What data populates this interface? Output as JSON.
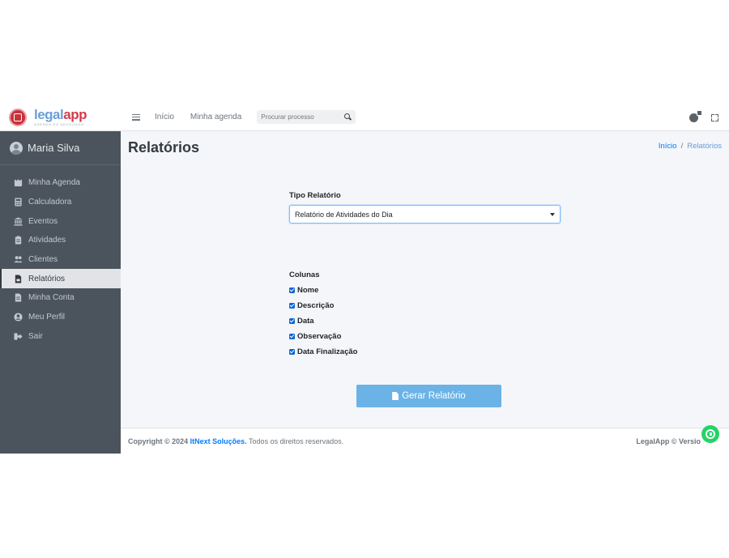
{
  "brand": {
    "name_part1": "legal",
    "name_part2": "app",
    "tagline": "AGENDA DO ADVOGADO"
  },
  "user": {
    "name": "Maria Silva"
  },
  "sidebar": {
    "items": [
      {
        "label": "Minha Agenda",
        "icon": "calendar-icon"
      },
      {
        "label": "Calculadora",
        "icon": "calculator-icon"
      },
      {
        "label": "Eventos",
        "icon": "landmark-icon"
      },
      {
        "label": "Atividades",
        "icon": "clipboard-icon"
      },
      {
        "label": "Clientes",
        "icon": "users-icon"
      },
      {
        "label": "Relatórios",
        "icon": "file-pdf-icon",
        "active": true
      },
      {
        "label": "Minha Conta",
        "icon": "file-invoice-icon"
      },
      {
        "label": "Meu Perfil",
        "icon": "user-circle-icon"
      },
      {
        "label": "Sair",
        "icon": "sign-out-icon"
      }
    ]
  },
  "topbar": {
    "links": [
      "Início",
      "Minha agenda"
    ],
    "search_placeholder": "Procurar processo"
  },
  "page": {
    "title": "Relatórios",
    "breadcrumb": {
      "home": "Início",
      "separator": "/",
      "current": "Relatórios"
    }
  },
  "form": {
    "tipo_label": "Tipo Relatório",
    "tipo_selected": "Relatório de Atividades do Dia",
    "colunas_label": "Colunas",
    "colunas": [
      {
        "label": "Nome",
        "checked": true
      },
      {
        "label": "Descrição",
        "checked": true
      },
      {
        "label": "Data",
        "checked": true
      },
      {
        "label": "Observação",
        "checked": true
      },
      {
        "label": "Data Finalização",
        "checked": true
      }
    ],
    "submit_label": "Gerar Relatório"
  },
  "footer": {
    "copyright": "Copyright © 2024",
    "company": "ItNext Soluções.",
    "rights": "Todos os direitos reservados.",
    "version": "LegalApp © Versio"
  },
  "colors": {
    "sidebar_bg": "#4b545c",
    "accent": "#007bff",
    "button": "#6bb3e6",
    "whatsapp": "#25d366"
  }
}
